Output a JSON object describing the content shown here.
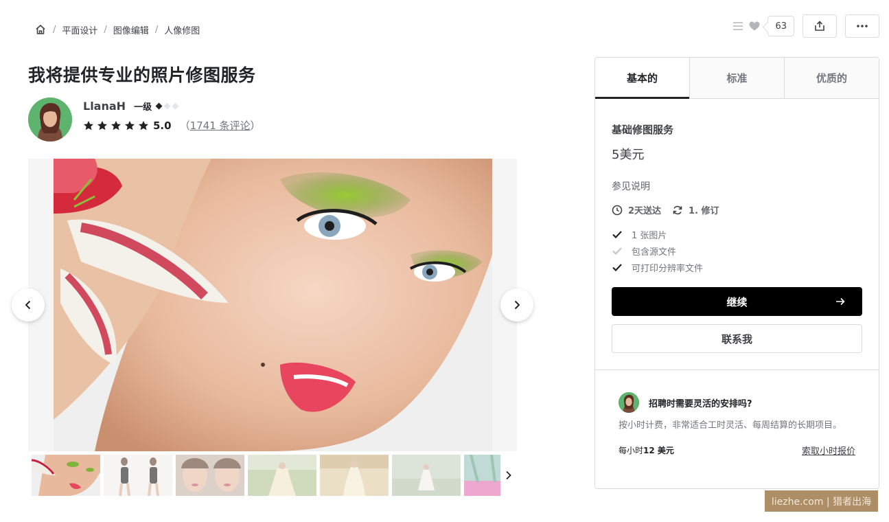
{
  "breadcrumb": {
    "items": [
      "平面设计",
      "图像编辑",
      "人像修图"
    ]
  },
  "actions": {
    "like_count": "63"
  },
  "gig": {
    "title": "我将提供专业的照片修图服务"
  },
  "seller": {
    "name": "LlanaH",
    "level": "一级",
    "level_diamonds_filled": 1,
    "level_diamonds_total": 3,
    "rating": "5.0",
    "reviews_open": "（",
    "reviews_link": "1741 条评论",
    "reviews_close": "）"
  },
  "package": {
    "tabs": [
      "基本的",
      "标准",
      "优质的"
    ],
    "active_tab": 0,
    "name": "基础修图服务",
    "price": "5美元",
    "description": "参见说明",
    "delivery": "2天送达",
    "revisions": "1. 修订",
    "features": [
      {
        "label": "1 张图片",
        "included": true
      },
      {
        "label": "包含源文件",
        "included": false
      },
      {
        "label": "可打印分辨率文件",
        "included": true
      }
    ],
    "continue_label": "继续",
    "contact_label": "联系我"
  },
  "hourly": {
    "title": "招聘时需要灵活的安排吗?",
    "text": "按小时计费，非常适合工时灵活、每周结算的长期项目。",
    "rate_prefix": "每小时",
    "rate_value": "12 美元",
    "link": "索取小时报价"
  },
  "watermark": "liezhe.com | 猎者出海",
  "colors": {
    "accent": "#000000",
    "text_primary": "#222325",
    "text_secondary": "#74767e",
    "border": "#dadbdd",
    "avatar_bg": "#5eb46f"
  },
  "icons": {
    "home": "home-icon",
    "menu": "menu-icon",
    "heart": "heart-icon",
    "share": "share-icon",
    "more": "more-icon",
    "clock": "clock-icon",
    "refresh": "refresh-icon",
    "check": "check-icon",
    "arrow_right": "arrow-right-icon",
    "chevron_left": "chevron-left-icon",
    "chevron_right": "chevron-right-icon"
  }
}
